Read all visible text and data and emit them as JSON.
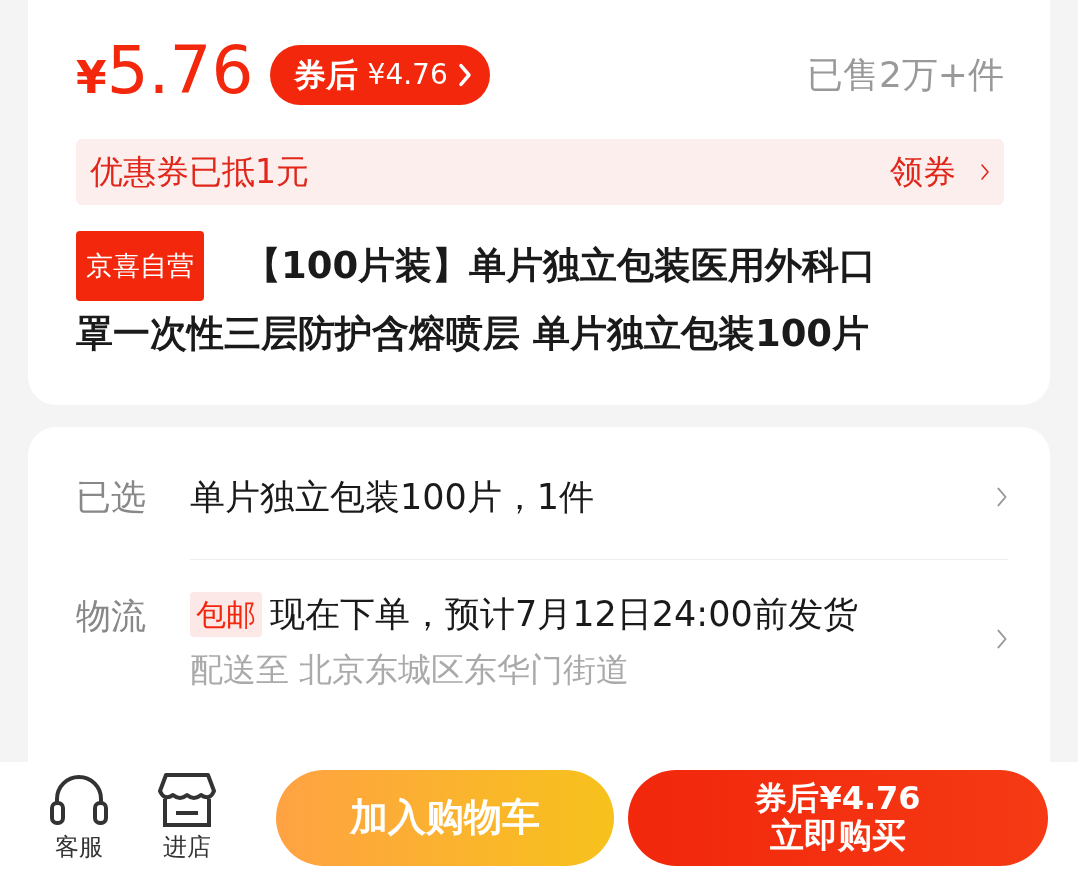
{
  "price": {
    "currency": "¥",
    "amount": "5.76"
  },
  "coupon_price_button": {
    "label": "券后",
    "price": "¥4.76"
  },
  "sold": "已售2万+件",
  "coupon_banner": {
    "text": "优惠券已抵1元",
    "action": "领券"
  },
  "product": {
    "tag": "京喜自营",
    "title_lines": [
      "【100片装】单片独立包装医用外科口",
      "罩一次性三层防护含熔喷层 单片独立包装100片"
    ]
  },
  "details": [
    {
      "kind": "selection",
      "label": "已选",
      "value": "单片独立包装100片，1件"
    },
    {
      "kind": "shipping",
      "label": "物流",
      "badge": "包邮",
      "value": "现在下单，预计7月12日24:00前发货",
      "sub": "配送至 北京东城区东华门街道"
    }
  ],
  "bottom_bar": {
    "icons": [
      {
        "kind": "headset",
        "label": "客服"
      },
      {
        "kind": "store",
        "label": "进店"
      }
    ],
    "cart_button": "加入购物车",
    "buy_button": {
      "note": "券后¥4.76",
      "label": "立即购买"
    }
  }
}
